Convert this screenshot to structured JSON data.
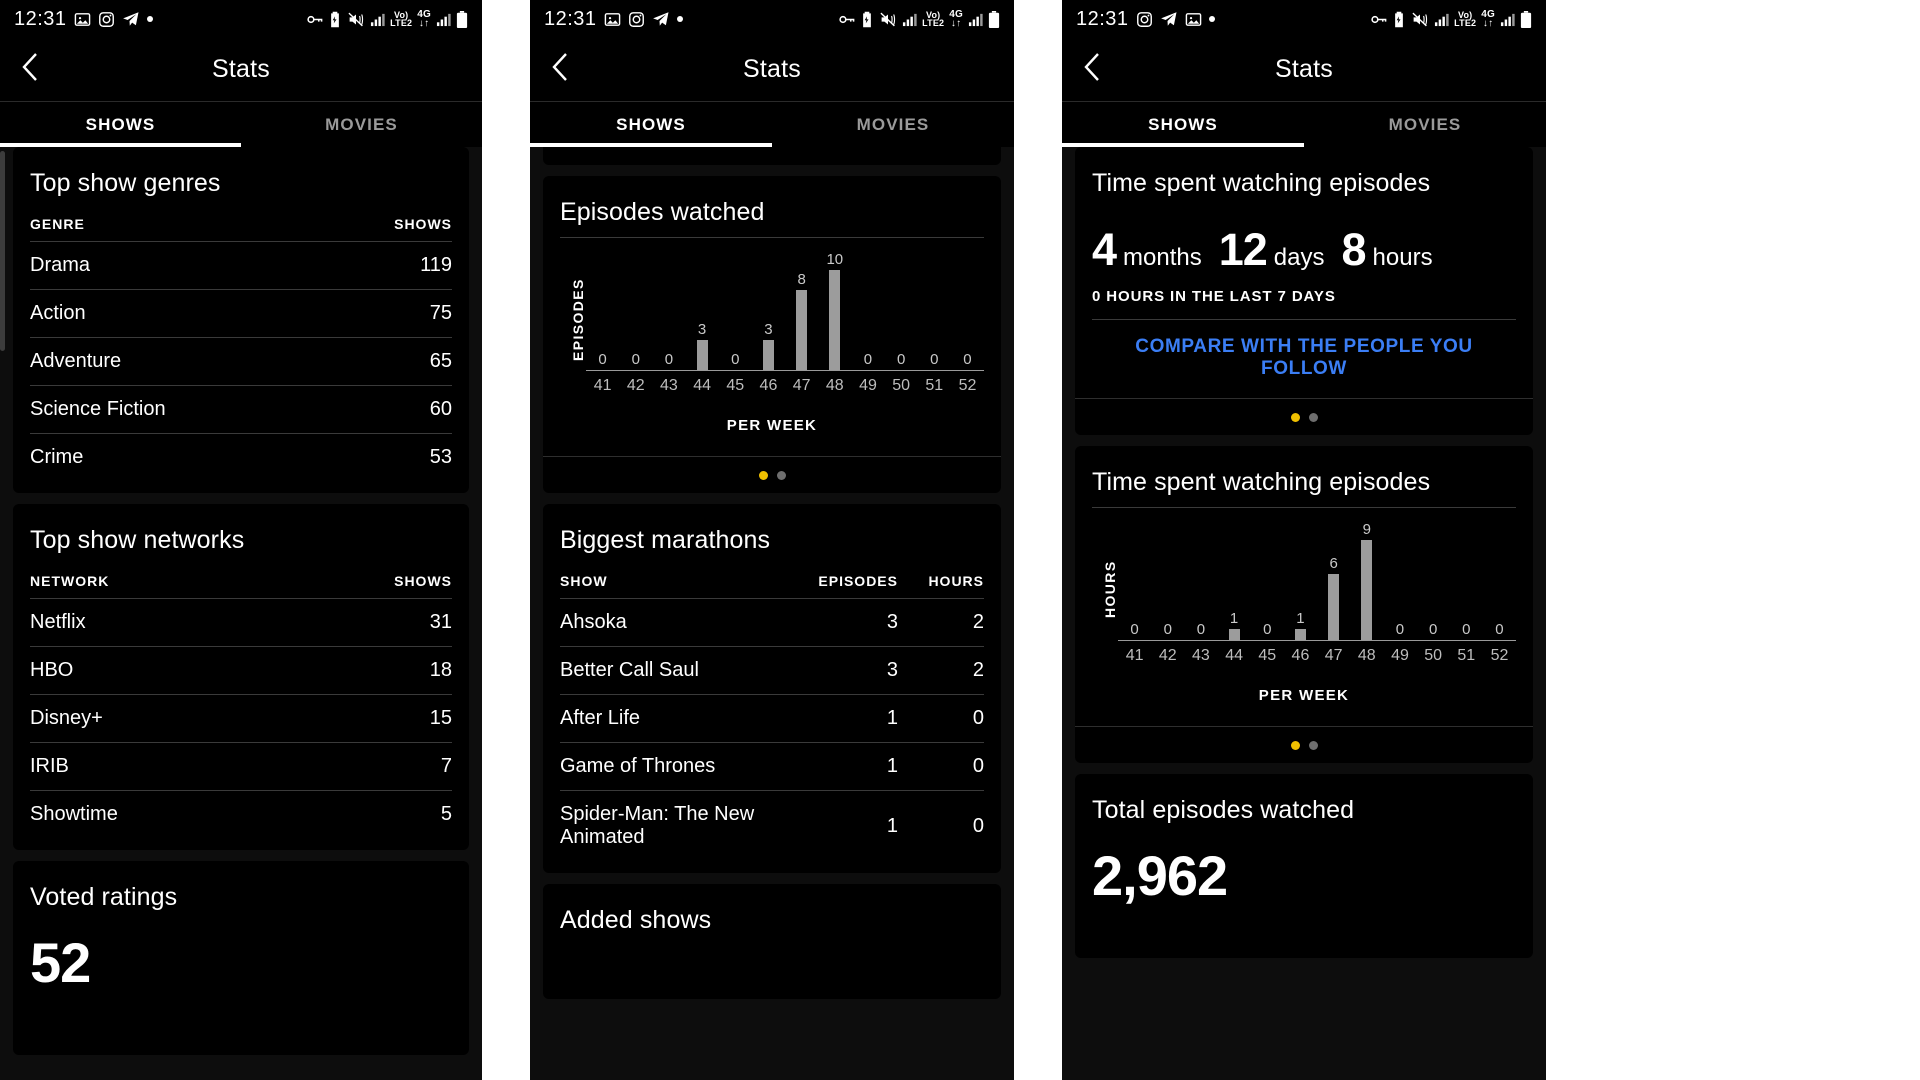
{
  "status_bar": {
    "time": "12:31",
    "left_icons": [
      "image-icon",
      "instagram-icon",
      "telegram-icon",
      "dot-icon"
    ],
    "right_icons": [
      "vpn-key-icon",
      "battery-saver-icon",
      "mute-vibrate-icon",
      "signal-bars-icon",
      "volte-icon",
      "fourg-icon",
      "signal-bars-2-icon",
      "battery-icon"
    ],
    "volte_top": "Vo)",
    "volte_bottom": "LTE2",
    "fourg_top": "4G",
    "fourg_bottom": "↓↑"
  },
  "app_bar": {
    "title": "Stats",
    "back_icon": "chevron-left-icon"
  },
  "tabs": [
    {
      "label": "SHOWS",
      "active": true
    },
    {
      "label": "MOVIES",
      "active": false
    }
  ],
  "colors": {
    "accent_link": "#3b7ef5",
    "dot_active": "#f0c000",
    "dot_inactive": "#6e6e6e",
    "bar": "#9c9c9c",
    "card_bg": "#000000",
    "page_bg": "#0d0d0d"
  },
  "panel1": {
    "genres_card": {
      "title": "Top show genres",
      "headers": [
        "GENRE",
        "SHOWS"
      ],
      "rows": [
        {
          "name": "Drama",
          "count": "119"
        },
        {
          "name": "Action",
          "count": "75"
        },
        {
          "name": "Adventure",
          "count": "65"
        },
        {
          "name": "Science Fiction",
          "count": "60"
        },
        {
          "name": "Crime",
          "count": "53"
        }
      ]
    },
    "networks_card": {
      "title": "Top show networks",
      "headers": [
        "NETWORK",
        "SHOWS"
      ],
      "rows": [
        {
          "name": "Netflix",
          "count": "31"
        },
        {
          "name": "HBO",
          "count": "18"
        },
        {
          "name": "Disney+",
          "count": "15"
        },
        {
          "name": "IRIB",
          "count": "7"
        },
        {
          "name": "Showtime",
          "count": "5"
        }
      ]
    },
    "ratings_card": {
      "title": "Voted ratings",
      "value": "52"
    }
  },
  "panel2": {
    "episodes_card": {
      "title": "Episodes watched",
      "pager": {
        "total": 2,
        "active_index": 0
      }
    },
    "marathons_card": {
      "title": "Biggest marathons",
      "headers": [
        "SHOW",
        "EPISODES",
        "HOURS"
      ],
      "rows": [
        {
          "show": "Ahsoka",
          "episodes": "3",
          "hours": "2"
        },
        {
          "show": "Better Call Saul",
          "episodes": "3",
          "hours": "2"
        },
        {
          "show": "After Life",
          "episodes": "1",
          "hours": "0"
        },
        {
          "show": "Game of Thrones",
          "episodes": "1",
          "hours": "0"
        },
        {
          "show": "Spider-Man: The New Animated",
          "episodes": "1",
          "hours": "0"
        }
      ]
    },
    "added_card": {
      "title": "Added shows"
    }
  },
  "panel3": {
    "time_card": {
      "title": "Time spent watching episodes",
      "months_value": "4",
      "months_label": "months",
      "days_value": "12",
      "days_label": "days",
      "hours_value": "8",
      "hours_label": "hours",
      "subnote": "0 HOURS IN THE LAST 7 DAYS",
      "compare_link": "COMPARE WITH THE PEOPLE YOU FOLLOW",
      "pager": {
        "total": 2,
        "active_index": 0
      }
    },
    "hours_chart_card": {
      "title": "Time spent watching episodes",
      "pager": {
        "total": 2,
        "active_index": 0
      }
    },
    "total_card": {
      "title": "Total episodes watched",
      "value": "2,962"
    }
  },
  "chart_data": [
    {
      "id": "episodes-watched-per-week",
      "type": "bar",
      "title": "Episodes watched",
      "ylabel": "EPISODES",
      "xlabel": "PER WEEK",
      "categories": [
        "41",
        "42",
        "43",
        "44",
        "45",
        "46",
        "47",
        "48",
        "49",
        "50",
        "51",
        "52"
      ],
      "values": [
        0,
        0,
        0,
        3,
        0,
        3,
        8,
        10,
        0,
        0,
        0,
        0
      ],
      "ylim": [
        0,
        10
      ],
      "grid": false,
      "legend": "none",
      "data_labels": true
    },
    {
      "id": "hours-watching-per-week",
      "type": "bar",
      "title": "Time spent watching episodes",
      "ylabel": "HOURS",
      "xlabel": "PER WEEK",
      "categories": [
        "41",
        "42",
        "43",
        "44",
        "45",
        "46",
        "47",
        "48",
        "49",
        "50",
        "51",
        "52"
      ],
      "values": [
        0,
        0,
        0,
        1,
        0,
        1,
        6,
        9,
        0,
        0,
        0,
        0
      ],
      "ylim": [
        0,
        9
      ],
      "grid": false,
      "legend": "none",
      "data_labels": true
    }
  ]
}
